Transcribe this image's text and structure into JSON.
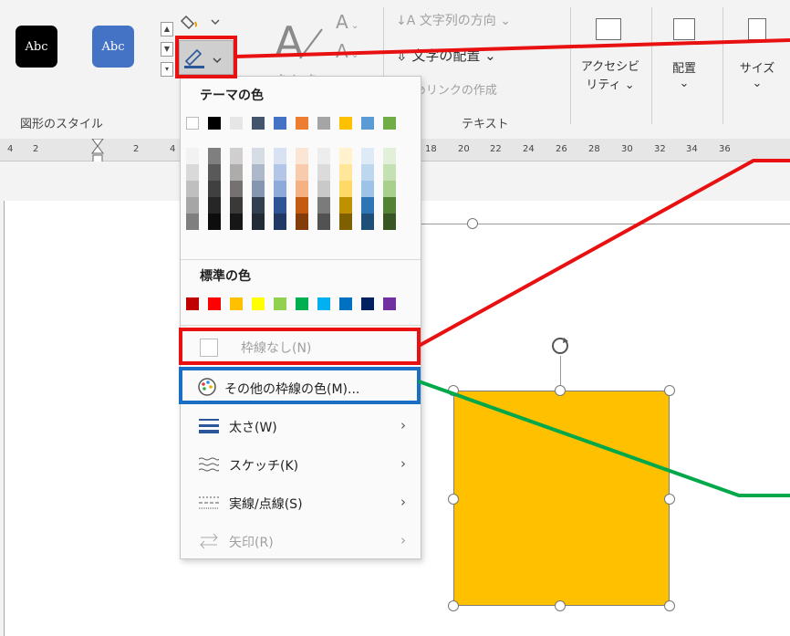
{
  "ribbon": {
    "style_presets": [
      "Abc",
      "Abc"
    ],
    "group_shape_styles": "図形のスタイル",
    "wordart_label": "クイック",
    "text_direction": "文字列の方向",
    "text_align": "文字の配置",
    "create_link": "リンクの作成",
    "group_text": "テキスト",
    "accessibility_line1": "アクセシビ",
    "accessibility_line2": "リティ",
    "arrange": "配置",
    "size": "サイズ",
    "colors": {
      "black_preset": "#000000",
      "blue_preset": "#4472c4",
      "accent": "#2b579a"
    }
  },
  "ruler": {
    "left_ticks": [
      "4",
      "2",
      "2",
      "4"
    ],
    "right_ticks": [
      "18",
      "20",
      "22",
      "24",
      "26",
      "28",
      "30",
      "32",
      "34",
      "36"
    ]
  },
  "menu": {
    "theme_heading": "テーマの色",
    "theme_colors": [
      "#ffffff",
      "#000000",
      "#e7e6e6",
      "#44546a",
      "#4472c4",
      "#ed7d31",
      "#a5a5a5",
      "#ffc000",
      "#5b9bd5",
      "#70ad47"
    ],
    "theme_shades": [
      [
        "#f2f2f2",
        "#d9d9d9",
        "#bfbfbf",
        "#a6a6a6",
        "#7f7f7f"
      ],
      [
        "#7f7f7f",
        "#595959",
        "#404040",
        "#262626",
        "#0d0d0d"
      ],
      [
        "#d0cece",
        "#aeabab",
        "#757171",
        "#3b3838",
        "#171616"
      ],
      [
        "#d6dce4",
        "#adb9ca",
        "#8496b0",
        "#323f4f",
        "#222a35"
      ],
      [
        "#d9e2f3",
        "#b4c6e7",
        "#8eaadb",
        "#2f5496",
        "#1f3864"
      ],
      [
        "#fbe5d5",
        "#f7cbac",
        "#f4b183",
        "#c55a11",
        "#843c0b"
      ],
      [
        "#ededed",
        "#dbdbdb",
        "#c9c9c9",
        "#7b7b7b",
        "#525252"
      ],
      [
        "#fff2cc",
        "#ffe699",
        "#ffd966",
        "#bf9000",
        "#7f6000"
      ],
      [
        "#deebf6",
        "#bdd7ee",
        "#9dc3e6",
        "#2e75b5",
        "#1f4e79"
      ],
      [
        "#e2efd9",
        "#c5e0b3",
        "#a8d08d",
        "#538135",
        "#375623"
      ]
    ],
    "standard_heading": "標準の色",
    "standard_colors": [
      "#c00000",
      "#ff0000",
      "#ffc000",
      "#ffff00",
      "#92d050",
      "#00b050",
      "#00b0f0",
      "#0070c0",
      "#002060",
      "#7030a0"
    ],
    "no_outline": "枠線なし(N)",
    "more_colors": "その他の枠線の色(M)...",
    "weight": "太さ(W)",
    "sketch": "スケッチ(K)",
    "dashes": "実線/点線(S)",
    "arrows": "矢印(R)"
  },
  "shape": {
    "fill": "#ffc000",
    "outline": "#7f7f7f"
  },
  "annotations": {
    "red": "#e81010",
    "blue": "#1a6fc4",
    "green": "#00a84a"
  }
}
